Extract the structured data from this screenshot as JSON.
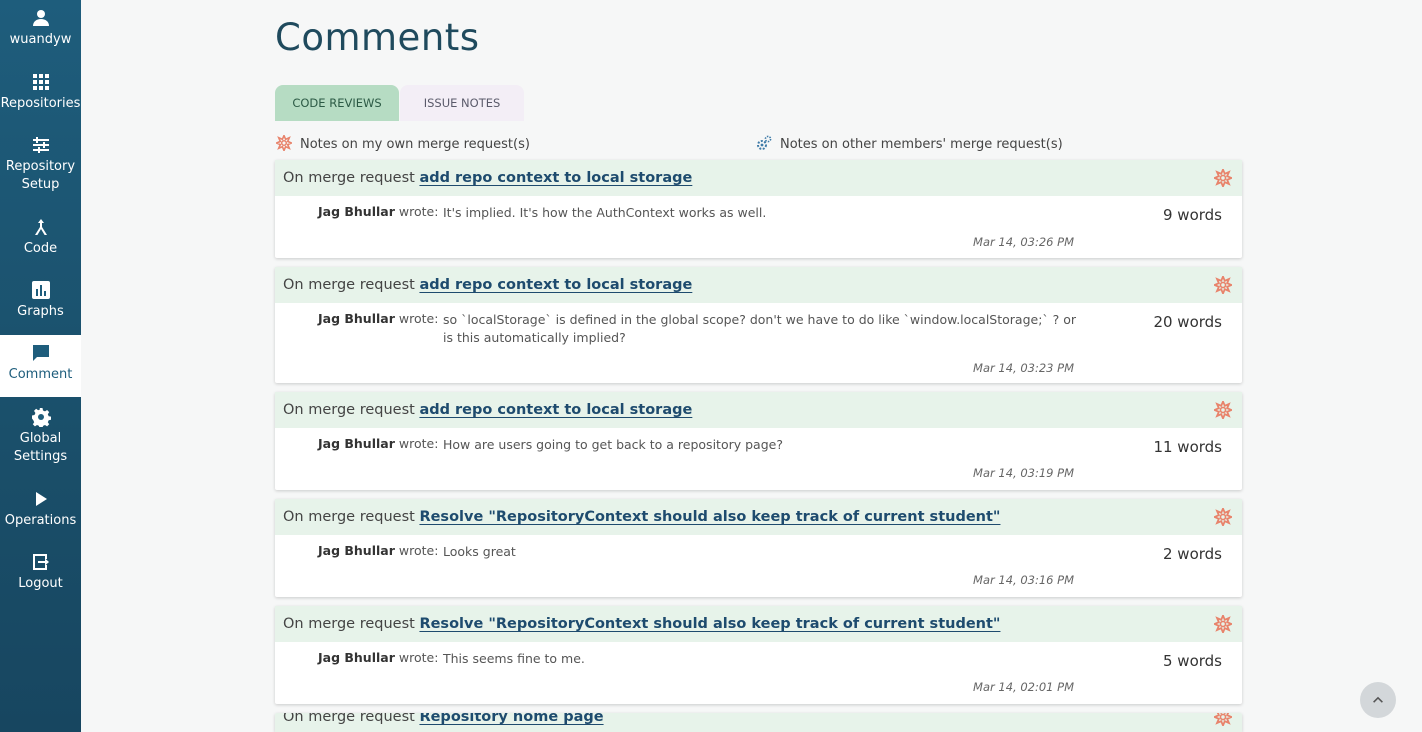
{
  "sidebar": {
    "user": "wuandyw",
    "items": [
      {
        "label_1": "Repositories",
        "label_2": ""
      },
      {
        "label_1": "Repository",
        "label_2": "Setup"
      },
      {
        "label_1": "Code",
        "label_2": ""
      },
      {
        "label_1": "Graphs",
        "label_2": ""
      },
      {
        "label_1": "Comment",
        "label_2": ""
      },
      {
        "label_1": "Global",
        "label_2": "Settings"
      },
      {
        "label_1": "Operations",
        "label_2": ""
      },
      {
        "label_1": "Logout",
        "label_2": ""
      }
    ],
    "active": "Comment"
  },
  "page": {
    "title": "Comments"
  },
  "tabs": [
    "CODE REVIEWS",
    "ISSUE NOTES"
  ],
  "legend": {
    "own": "Notes on my own merge request(s)",
    "others": "Notes on other members' merge request(s)"
  },
  "prefix": "On merge request",
  "cards": [
    {
      "mr": "add repo context to local storage",
      "author": "Jag Bhullar",
      "wrote": "wrote:",
      "text": "It's implied. It's how the AuthContext works as well.",
      "words": "9 words",
      "date": "Mar 14, 03:26 PM"
    },
    {
      "mr": "add repo context to local storage",
      "author": "Jag Bhullar",
      "wrote": "wrote:",
      "text": "so `localStorage` is defined in the global scope? don't we have to do like `window.localStorage;` ? or is this automatically implied?",
      "words": "20 words",
      "date": "Mar 14, 03:23 PM"
    },
    {
      "mr": "add repo context to local storage",
      "author": "Jag Bhullar",
      "wrote": "wrote:",
      "text": "How are users going to get back to a repository page?",
      "words": "11 words",
      "date": "Mar 14, 03:19 PM"
    },
    {
      "mr": "Resolve \"RepositoryContext should also keep track of current student\"",
      "author": "Jag Bhullar",
      "wrote": "wrote:",
      "text": "Looks great",
      "words": "2 words",
      "date": "Mar 14, 03:16 PM"
    },
    {
      "mr": "Resolve \"RepositoryContext should also keep track of current student\"",
      "author": "Jag Bhullar",
      "wrote": "wrote:",
      "text": "This seems fine to me.",
      "words": "5 words",
      "date": "Mar 14, 02:01 PM"
    },
    {
      "mr": "Repository home page"
    }
  ],
  "icons": {
    "own_note": "gear-star-icon",
    "other_note": "gears-icon",
    "scroll_top": "chevron-up-icon"
  },
  "colors": {
    "sidebar": "#1e5d7c",
    "header_bg": "#e7f3ea",
    "accent_star": "#e8836b",
    "link": "#1e4b6e"
  }
}
